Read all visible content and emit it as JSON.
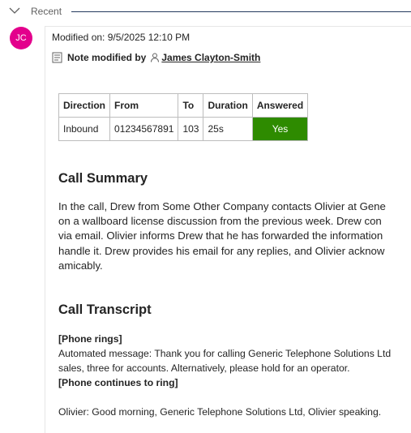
{
  "section": {
    "title": "Recent"
  },
  "avatar": {
    "initials": "JC",
    "color": "#e3008c"
  },
  "note": {
    "modified_on": "Modified on: 9/5/2025 12:10 PM",
    "modified_by_label": "Note modified by",
    "author": "James Clayton-Smith"
  },
  "call_table": {
    "headers": [
      "Direction",
      "From",
      "To",
      "Duration",
      "Answered"
    ],
    "row": [
      "Inbound",
      "01234567891",
      "103",
      "25s",
      "Yes"
    ],
    "answered_color": "#2e8b00"
  },
  "summary": {
    "heading": "Call Summary",
    "lines": [
      "In the call, Drew from Some Other Company contacts Olivier at Gene",
      "on a wallboard license discussion from the previous week. Drew con",
      "via email. Olivier informs Drew that he has forwarded the information",
      "handle it. Drew provides his email for any replies, and Olivier acknow",
      "amicably."
    ]
  },
  "transcript": {
    "heading": "Call Transcript",
    "phone_rings": "[Phone rings]",
    "automated_line1": "Automated message: Thank you for calling Generic Telephone Solutions Ltd",
    "automated_line2": "sales, three for accounts. Alternatively, please hold for an operator.",
    "continues": "[Phone continues to ring]",
    "olivier": "Olivier: Good morning, Generic Telephone Solutions Ltd, Olivier speaking."
  }
}
